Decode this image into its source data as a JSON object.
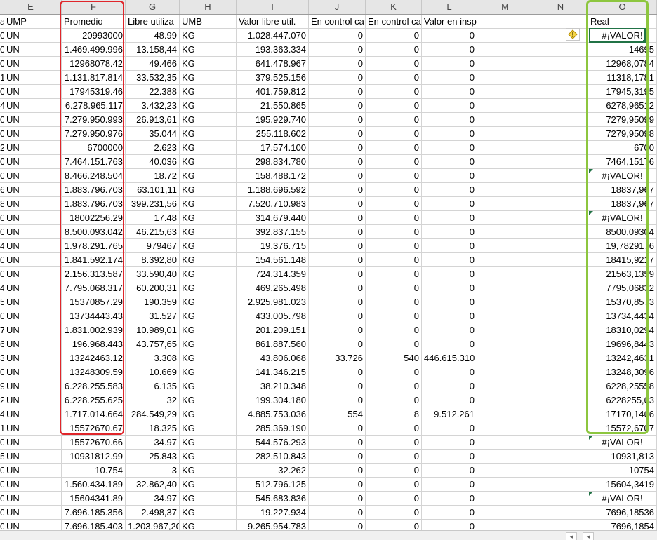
{
  "columns": [
    "E",
    "F",
    "G",
    "H",
    "I",
    "J",
    "K",
    "L",
    "M",
    "N",
    "O"
  ],
  "header_row": {
    "c0": "a",
    "E": "UMP",
    "F": "Promedio",
    "G": "Libre utiliza",
    "H": "UMB",
    "I": "Valor libre util.",
    "J": "En control ca",
    "K": "En control ca",
    "L": "Valor en insp.cal.",
    "M": "",
    "N": "",
    "O": "Real"
  },
  "rows": [
    [
      "0",
      "UN",
      "20993000",
      "48.99",
      "KG",
      "1.028.447.070",
      "0",
      "0",
      "0",
      "",
      "",
      "#¡VALOR!"
    ],
    [
      "0",
      "UN",
      "1.469.499.996",
      "13.158,44",
      "KG",
      "193.363.334",
      "0",
      "0",
      "0",
      "",
      "",
      "14695"
    ],
    [
      "0",
      "UN",
      "12968078.42",
      "49.466",
      "KG",
      "641.478.967",
      "0",
      "0",
      "0",
      "",
      "",
      "12968,0784"
    ],
    [
      "1",
      "UN",
      "1.131.817.814",
      "33.532,35",
      "KG",
      "379.525.156",
      "0",
      "0",
      "0",
      "",
      "",
      "11318,1781"
    ],
    [
      "0",
      "UN",
      "17945319.46",
      "22.388",
      "KG",
      "401.759.812",
      "0",
      "0",
      "0",
      "",
      "",
      "17945,3195"
    ],
    [
      "4",
      "UN",
      "6.278.965.117",
      "3.432,23",
      "KG",
      "21.550.865",
      "0",
      "0",
      "0",
      "",
      "",
      "6278,96512"
    ],
    [
      "0",
      "UN",
      "7.279.950.993",
      "26.913,61",
      "KG",
      "195.929.740",
      "0",
      "0",
      "0",
      "",
      "",
      "7279,95099"
    ],
    [
      "0",
      "UN",
      "7.279.950.976",
      "35.044",
      "KG",
      "255.118.602",
      "0",
      "0",
      "0",
      "",
      "",
      "7279,95098"
    ],
    [
      "2",
      "UN",
      "6700000",
      "2.623",
      "KG",
      "17.574.100",
      "0",
      "0",
      "0",
      "",
      "",
      "6700"
    ],
    [
      "0",
      "UN",
      "7.464.151.763",
      "40.036",
      "KG",
      "298.834.780",
      "0",
      "0",
      "0",
      "",
      "",
      "7464,15176"
    ],
    [
      "0",
      "UN",
      "8.466.248.504",
      "18.72",
      "KG",
      "158.488.172",
      "0",
      "0",
      "0",
      "",
      "",
      "#¡VALOR!"
    ],
    [
      "6",
      "UN",
      "1.883.796.703",
      "63.101,11",
      "KG",
      "1.188.696.592",
      "0",
      "0",
      "0",
      "",
      "",
      "18837,967"
    ],
    [
      "8",
      "UN",
      "1.883.796.703",
      "399.231,56",
      "KG",
      "7.520.710.983",
      "0",
      "0",
      "0",
      "",
      "",
      "18837,967"
    ],
    [
      "0",
      "UN",
      "18002256.29",
      "17.48",
      "KG",
      "314.679.440",
      "0",
      "0",
      "0",
      "",
      "",
      "#¡VALOR!"
    ],
    [
      "0",
      "UN",
      "8.500.093.042",
      "46.215,63",
      "KG",
      "392.837.155",
      "0",
      "0",
      "0",
      "",
      "",
      "8500,09304"
    ],
    [
      "4",
      "UN",
      "1.978.291.765",
      "979467",
      "KG",
      "19.376.715",
      "0",
      "0",
      "0",
      "",
      "",
      "19,7829176"
    ],
    [
      "0",
      "UN",
      "1.841.592.174",
      "8.392,80",
      "KG",
      "154.561.148",
      "0",
      "0",
      "0",
      "",
      "",
      "18415,9217"
    ],
    [
      "0",
      "UN",
      "2.156.313.587",
      "33.590,40",
      "KG",
      "724.314.359",
      "0",
      "0",
      "0",
      "",
      "",
      "21563,1359"
    ],
    [
      "4",
      "UN",
      "7.795.068.317",
      "60.200,31",
      "KG",
      "469.265.498",
      "0",
      "0",
      "0",
      "",
      "",
      "7795,06832"
    ],
    [
      "5",
      "UN",
      "15370857.29",
      "190.359",
      "KG",
      "2.925.981.023",
      "0",
      "0",
      "0",
      "",
      "",
      "15370,8573"
    ],
    [
      "0",
      "UN",
      "13734443.43",
      "31.527",
      "KG",
      "433.005.798",
      "0",
      "0",
      "0",
      "",
      "",
      "13734,4434"
    ],
    [
      "7",
      "UN",
      "1.831.002.939",
      "10.989,01",
      "KG",
      "201.209.151",
      "0",
      "0",
      "0",
      "",
      "",
      "18310,0294"
    ],
    [
      "6",
      "UN",
      "196.968.443",
      "43.757,65",
      "KG",
      "861.887.560",
      "0",
      "0",
      "0",
      "",
      "",
      "19696,8443"
    ],
    [
      "3",
      "UN",
      "13242463.12",
      "3.308",
      "KG",
      "43.806.068",
      "33.726",
      "540",
      "446.615.310",
      "",
      "",
      "13242,4631"
    ],
    [
      "0",
      "UN",
      "13248309.59",
      "10.669",
      "KG",
      "141.346.215",
      "0",
      "0",
      "0",
      "",
      "",
      "13248,3096"
    ],
    [
      "9",
      "UN",
      "6.228.255.583",
      "6.135",
      "KG",
      "38.210.348",
      "0",
      "0",
      "0",
      "",
      "",
      "6228,25558"
    ],
    [
      "2",
      "UN",
      "6.228.255.625",
      "32",
      "KG",
      "199.304.180",
      "0",
      "0",
      "0",
      "",
      "",
      "6228255,63"
    ],
    [
      "4",
      "UN",
      "1.717.014.664",
      "284.549,29",
      "KG",
      "4.885.753.036",
      "554",
      "8",
      "9.512.261",
      "",
      "",
      "17170,1466"
    ],
    [
      "1",
      "UN",
      "15572670.67",
      "18.325",
      "KG",
      "285.369.190",
      "0",
      "0",
      "0",
      "",
      "",
      "15572,6707"
    ],
    [
      "0",
      "UN",
      "15572670.66",
      "34.97",
      "KG",
      "544.576.293",
      "0",
      "0",
      "0",
      "",
      "",
      "#¡VALOR!"
    ],
    [
      "5",
      "UN",
      "10931812.99",
      "25.843",
      "KG",
      "282.510.843",
      "0",
      "0",
      "0",
      "",
      "",
      "10931,813"
    ],
    [
      "0",
      "UN",
      "10.754",
      "3",
      "KG",
      "32.262",
      "0",
      "0",
      "0",
      "",
      "",
      "10754"
    ],
    [
      "0",
      "UN",
      "1.560.434.189",
      "32.862,40",
      "KG",
      "512.796.125",
      "0",
      "0",
      "0",
      "",
      "",
      "15604,3419"
    ],
    [
      "0",
      "UN",
      "15604341.89",
      "34.97",
      "KG",
      "545.683.836",
      "0",
      "0",
      "0",
      "",
      "",
      "#¡VALOR!"
    ],
    [
      "0",
      "UN",
      "7.696.185.356",
      "2.498,37",
      "KG",
      "19.227.934",
      "0",
      "0",
      "0",
      "",
      "",
      "7696,18536"
    ],
    [
      "0",
      "UN",
      "7.696.185.403",
      "1.203.967,20",
      "KG",
      "9.265.954.783",
      "0",
      "0",
      "0",
      "",
      "",
      "7696,1854"
    ]
  ],
  "error_icon": "warning-diamond-icon",
  "colors": {
    "highlight_promedio": "#e0262b",
    "highlight_real": "#8dc63f",
    "selection": "#217346"
  }
}
